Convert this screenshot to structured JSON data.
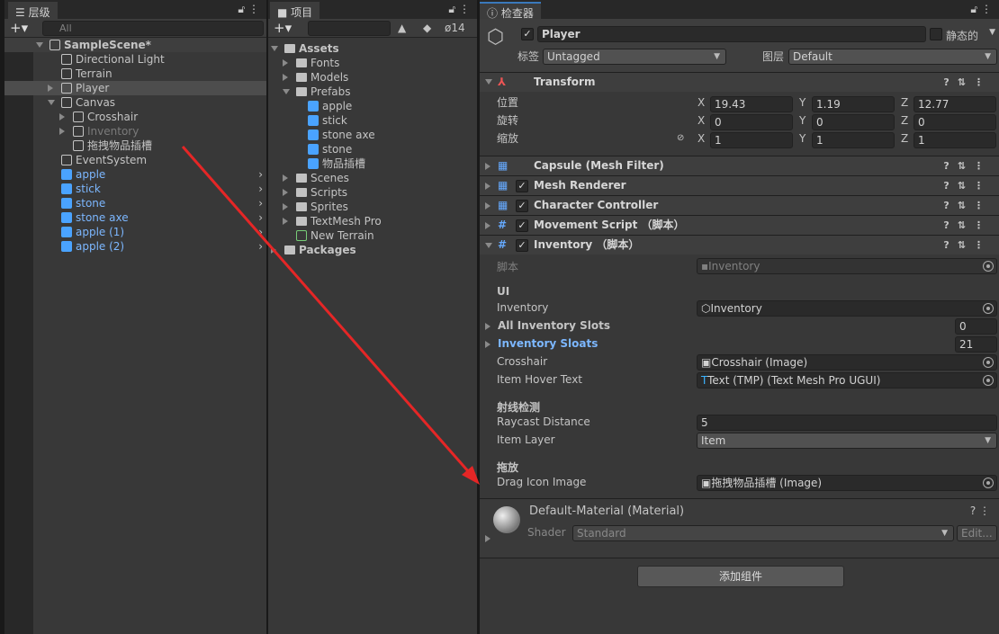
{
  "hierarchy": {
    "tab": "层级",
    "search_placeholder": "All",
    "items": [
      {
        "label": "SampleScene*",
        "depth": 0,
        "arrow": "down",
        "icon": "unity-scene-icon",
        "style": "bold"
      },
      {
        "label": "Directional Light",
        "depth": 1,
        "icon": "gameobject-icon"
      },
      {
        "label": "Terrain",
        "depth": 1,
        "icon": "gameobject-icon"
      },
      {
        "label": "Player",
        "depth": 1,
        "arrow": "right",
        "icon": "gameobject-icon",
        "selected": true
      },
      {
        "label": "Canvas",
        "depth": 1,
        "arrow": "down",
        "icon": "gameobject-icon"
      },
      {
        "label": "Crosshair",
        "depth": 2,
        "arrow": "right",
        "icon": "gameobject-icon"
      },
      {
        "label": "Inventory",
        "depth": 2,
        "arrow": "right",
        "icon": "gameobject-icon",
        "style": "dim"
      },
      {
        "label": "拖拽物品插槽",
        "depth": 2,
        "icon": "gameobject-icon"
      },
      {
        "label": "EventSystem",
        "depth": 1,
        "icon": "gameobject-icon"
      },
      {
        "label": "apple",
        "depth": 1,
        "icon": "prefab-icon",
        "style": "prefab"
      },
      {
        "label": "stick",
        "depth": 1,
        "icon": "prefab-icon",
        "style": "prefab"
      },
      {
        "label": "stone",
        "depth": 1,
        "icon": "prefab-icon",
        "style": "prefab"
      },
      {
        "label": "stone axe",
        "depth": 1,
        "icon": "prefab-icon",
        "style": "prefab"
      },
      {
        "label": "apple (1)",
        "depth": 1,
        "icon": "prefab-icon",
        "style": "prefab"
      },
      {
        "label": "apple (2)",
        "depth": 1,
        "icon": "prefab-icon",
        "style": "prefab"
      }
    ]
  },
  "project": {
    "tab": "项目",
    "hidden_count": "14",
    "items": [
      {
        "label": "Assets",
        "depth": 0,
        "arrow": "down",
        "icon": "folder-open-icon",
        "style": "bold"
      },
      {
        "label": "Fonts",
        "depth": 1,
        "arrow": "right",
        "icon": "folder-icon"
      },
      {
        "label": "Models",
        "depth": 1,
        "arrow": "right",
        "icon": "folder-icon"
      },
      {
        "label": "Prefabs",
        "depth": 1,
        "arrow": "down",
        "icon": "folder-open-icon"
      },
      {
        "label": "apple",
        "depth": 2,
        "icon": "prefab-icon"
      },
      {
        "label": "stick",
        "depth": 2,
        "icon": "prefab-icon"
      },
      {
        "label": "stone axe",
        "depth": 2,
        "icon": "prefab-icon"
      },
      {
        "label": "stone",
        "depth": 2,
        "icon": "prefab-icon"
      },
      {
        "label": "物品插槽",
        "depth": 2,
        "icon": "prefab-icon"
      },
      {
        "label": "Scenes",
        "depth": 1,
        "arrow": "right",
        "icon": "folder-icon"
      },
      {
        "label": "Scripts",
        "depth": 1,
        "arrow": "right",
        "icon": "folder-icon"
      },
      {
        "label": "Sprites",
        "depth": 1,
        "arrow": "right",
        "icon": "folder-icon"
      },
      {
        "label": "TextMesh Pro",
        "depth": 1,
        "arrow": "right",
        "icon": "folder-icon"
      },
      {
        "label": "New Terrain",
        "depth": 1,
        "icon": "terrain-icon"
      },
      {
        "label": "Packages",
        "depth": 0,
        "arrow": "right",
        "icon": "folder-icon",
        "style": "bold"
      }
    ]
  },
  "inspector": {
    "tab": "检查器",
    "name": "Player",
    "static_label": "静态的",
    "tag_label": "标签",
    "tag": "Untagged",
    "layer_label": "图层",
    "layer": "Default",
    "transform": {
      "title": "Transform",
      "rows": [
        {
          "label": "位置",
          "x": "19.43",
          "y": "1.19",
          "z": "12.77"
        },
        {
          "label": "旋转",
          "x": "0",
          "y": "0",
          "z": "0"
        },
        {
          "label": "缩放",
          "x": "1",
          "y": "1",
          "z": "1"
        }
      ]
    },
    "axis": {
      "x": "X",
      "y": "Y",
      "z": "Z"
    },
    "components": [
      "Capsule (Mesh Filter)",
      "Mesh Renderer",
      "Character Controller",
      "Movement Script （脚本）",
      "Inventory （脚本）"
    ],
    "inventory": {
      "script_label": "脚本",
      "script_value": "Inventory",
      "header_ui": "UI",
      "inventory_label": "Inventory",
      "inventory_value": "Inventory",
      "all_slots_label": "All Inventory Slots",
      "all_slots_value": "0",
      "sloats_label": "Inventory Sloats",
      "sloats_value": "21",
      "crosshair_label": "Crosshair",
      "crosshair_value": "Crosshair (Image)",
      "hover_label": "Item Hover Text",
      "hover_value": "Text (TMP) (Text Mesh Pro UGUI)",
      "header_ray": "射线检测",
      "raycast_label": "Raycast Distance",
      "raycast_value": "5",
      "layer_label": "Item Layer",
      "layer_value": "Item",
      "header_drag": "拖放",
      "drag_label": "Drag Icon Image",
      "drag_value": "拖拽物品插槽 (Image)"
    },
    "material": {
      "title": "Default-Material (Material)",
      "shader_label": "Shader",
      "shader": "Standard",
      "edit": "Edit..."
    },
    "add_component": "添加组件"
  },
  "colors": {
    "prefab": "#7cb7ff",
    "selected_row": "#4d4d4d",
    "annotation_arrow": "#e52626"
  }
}
